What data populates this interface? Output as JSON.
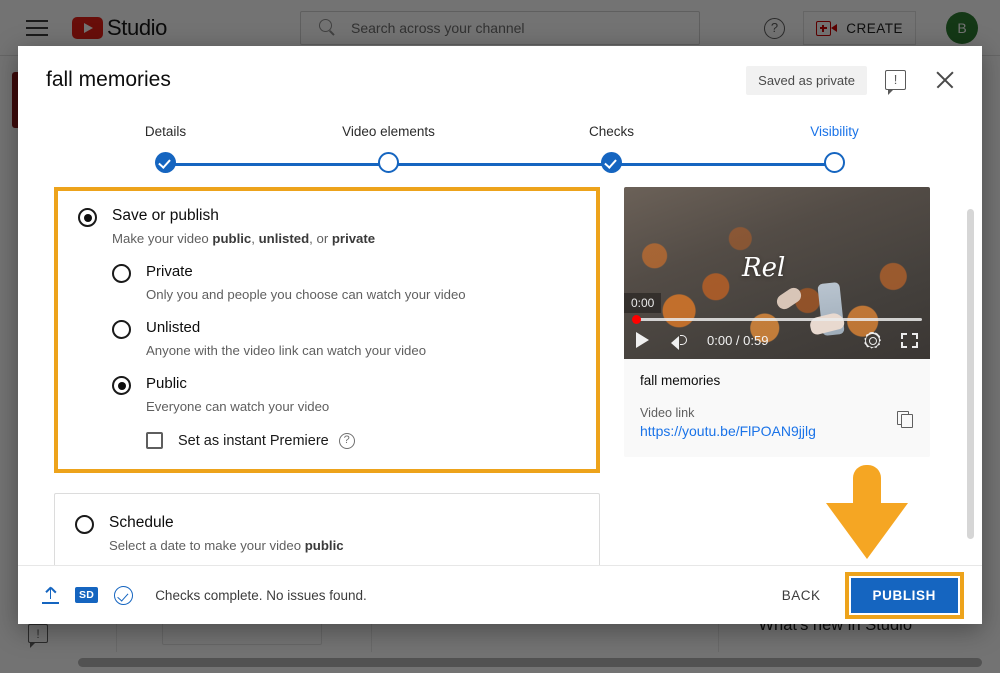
{
  "studio_header": {
    "menu_icon": "hamburger-icon",
    "brand": "Studio",
    "search_placeholder": "Search across your channel",
    "help_label": "?",
    "create_label": "CREATE",
    "avatar_initial": "B"
  },
  "background": {
    "whats_new": "What's new in Studio"
  },
  "dialog": {
    "title": "fall memories",
    "saved_status": "Saved as private",
    "feedback_icon_label": "!",
    "steps": [
      {
        "label": "Details",
        "state": "done"
      },
      {
        "label": "Video elements",
        "state": "open"
      },
      {
        "label": "Checks",
        "state": "done"
      },
      {
        "label": "Visibility",
        "state": "open",
        "active": true
      }
    ],
    "visibility": {
      "save_or_publish": {
        "label": "Save or publish",
        "description_prefix": "Make your video ",
        "description_b1": "public",
        "description_mid1": ", ",
        "description_b2": "unlisted",
        "description_mid2": ", or ",
        "description_b3": "private",
        "selected": true
      },
      "options": [
        {
          "label": "Private",
          "description": "Only you and people you choose can watch your video",
          "selected": false
        },
        {
          "label": "Unlisted",
          "description": "Anyone with the video link can watch your video",
          "selected": false
        },
        {
          "label": "Public",
          "description": "Everyone can watch your video",
          "selected": true
        }
      ],
      "premiere": {
        "label": "Set as instant Premiere",
        "checked": false,
        "help_label": "?"
      },
      "schedule": {
        "label": "Schedule",
        "description_prefix": "Select a date to make your video ",
        "description_bold": "public",
        "selected": false
      }
    },
    "preview": {
      "overlay_text": "Rel",
      "time_tooltip": "0:00",
      "time_display": "0:00 / 0:59",
      "title": "fall memories",
      "link_label": "Video link",
      "link_url": "https://youtu.be/FlPOAN9jjlg",
      "copy_icon": "copy-icon"
    },
    "footer": {
      "sd_badge": "SD",
      "status": "Checks complete. No issues found.",
      "back_label": "BACK",
      "publish_label": "PUBLISH"
    }
  },
  "colors": {
    "highlight": "#eda31b",
    "primary_blue": "#1565c0",
    "link_blue": "#1a73e8",
    "youtube_red": "#e62117"
  }
}
